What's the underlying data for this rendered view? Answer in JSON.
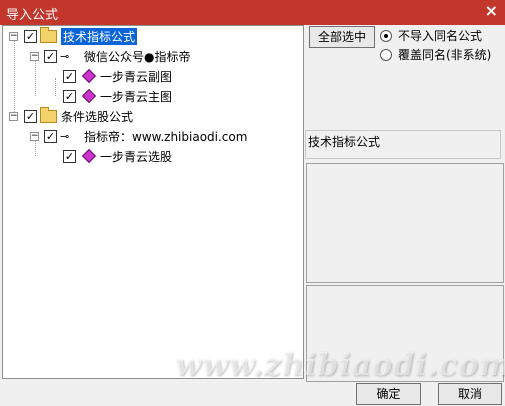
{
  "window": {
    "title": "导入公式",
    "close_glyph": "×"
  },
  "tree": {
    "nodes": [
      {
        "label": "技术指标公式",
        "selected": true
      },
      {
        "label": "微信公众号●指标帝"
      },
      {
        "label": "一步青云副图"
      },
      {
        "label": "一步青云主图"
      },
      {
        "label": "条件选股公式"
      },
      {
        "label": "指标帝：www.zhibiaodi.com"
      },
      {
        "label": "一步青云选股"
      }
    ]
  },
  "options": {
    "select_all_label": "全部选中",
    "radio_no_import_label": "不导入同名公式",
    "radio_overwrite_label": "覆盖同名(非系统)",
    "selected_radio": "不导入同名公式"
  },
  "info": {
    "category_label": "技术指标公式"
  },
  "footer": {
    "ok_label": "确定",
    "cancel_label": "取消"
  },
  "watermark": {
    "text": "www.zhibiaodi.com"
  }
}
